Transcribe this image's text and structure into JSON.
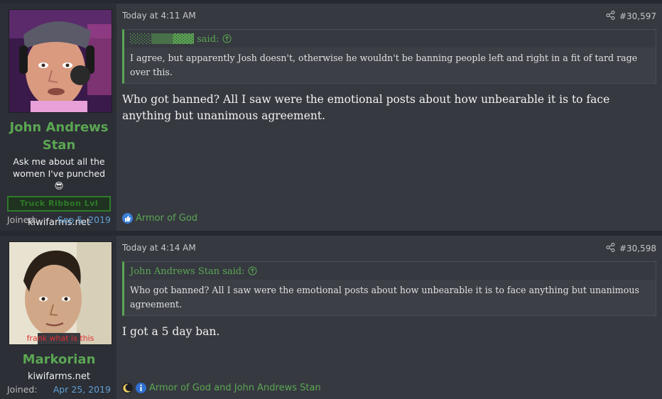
{
  "posts": [
    {
      "username": "John Andrews Stan",
      "user_title": "Ask me about all the women I've punched 😎",
      "banner": "Truck Ribbon Lvl",
      "site": "kiwifarms.net",
      "joined_label": "Joined:",
      "joined_date": "Sep 5, 2019",
      "timestamp": "Today at 4:11 AM",
      "post_number": "#30,597",
      "quote_author": "░░░▒▒▒▓▓▓ said:",
      "quote_text": "I agree, but apparently Josh doesn't, otherwise he wouldn't be banning people left and right in a fit of tard rage over this.",
      "body": "Who got banned? All I saw were the emotional posts about how unbearable it is to face anything but unanimous agreement.",
      "reactions": "Armor of God"
    },
    {
      "username": "Markorian",
      "avatar_caption": "frank what is this",
      "site": "kiwifarms.net",
      "joined_label": "Joined:",
      "joined_date": "Apr 25, 2019",
      "timestamp": "Today at 4:14 AM",
      "post_number": "#30,598",
      "quote_author": "John Andrews Stan said:",
      "quote_text": "Who got banned? All I saw were the emotional posts about how unbearable it is to face anything but unanimous agreement.",
      "body": "I got a 5 day ban.",
      "reactions": "Armor of God and John Andrews Stan"
    }
  ],
  "icons": {
    "share": "share-icon",
    "quote_arrow": "arrow-up-circle-icon",
    "like": "thumbs-up-icon"
  },
  "colors": {
    "accent_green": "#5ba653",
    "link_blue": "#5fa0d6",
    "post_bg": "#363940",
    "sidebar_bg": "#2c2f35"
  }
}
